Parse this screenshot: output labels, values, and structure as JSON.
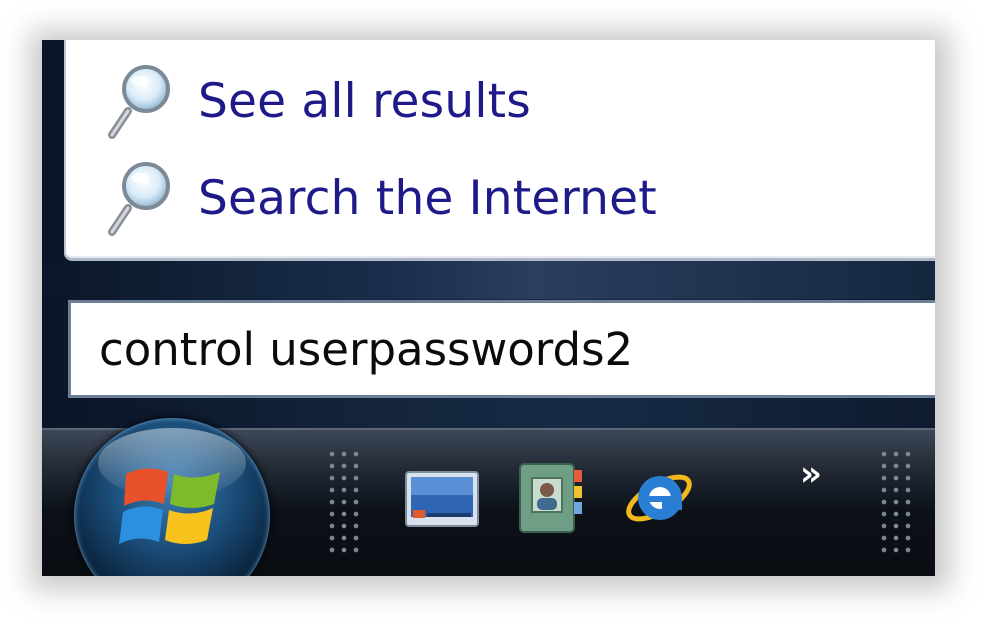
{
  "start_menu": {
    "results": [
      {
        "label": "See all results",
        "icon": "search-icon"
      },
      {
        "label": "Search the Internet",
        "icon": "search-icon"
      }
    ],
    "search": {
      "value": "control userpasswords2"
    }
  },
  "taskbar": {
    "start_button": {
      "icon": "windows-logo-icon"
    },
    "quick_launch": [
      {
        "icon": "show-desktop-icon"
      },
      {
        "icon": "contacts-icon"
      },
      {
        "icon": "internet-explorer-icon"
      }
    ],
    "overflow": {
      "label": "»"
    }
  }
}
